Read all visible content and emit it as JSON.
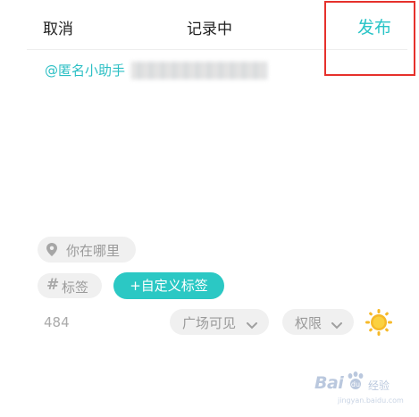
{
  "header": {
    "cancel_label": "取消",
    "title": "记录中",
    "publish_label": "发布"
  },
  "editor": {
    "mention_text": "@匿名小助手"
  },
  "location": {
    "label": "你在哪里",
    "icon": "location-pin-icon"
  },
  "tag": {
    "hash_symbol": "#",
    "label": "标签",
    "icon": "hash-icon"
  },
  "custom_tag": {
    "label": "+自定义标签"
  },
  "footer": {
    "char_count": "484",
    "visibility_label": "广场可见",
    "permission_label": "权限",
    "mood_icon": "sun-icon"
  },
  "watermark": {
    "brand": "Bai",
    "brand_suffix": "经验",
    "url": "jingyan.baidu.com"
  },
  "colors": {
    "accent": "#29c4c7",
    "custom_tag_bg": "#2bc8c4",
    "chip_bg": "#f0f0f0",
    "highlight": "#e6312c",
    "sun": "#f6b928"
  }
}
